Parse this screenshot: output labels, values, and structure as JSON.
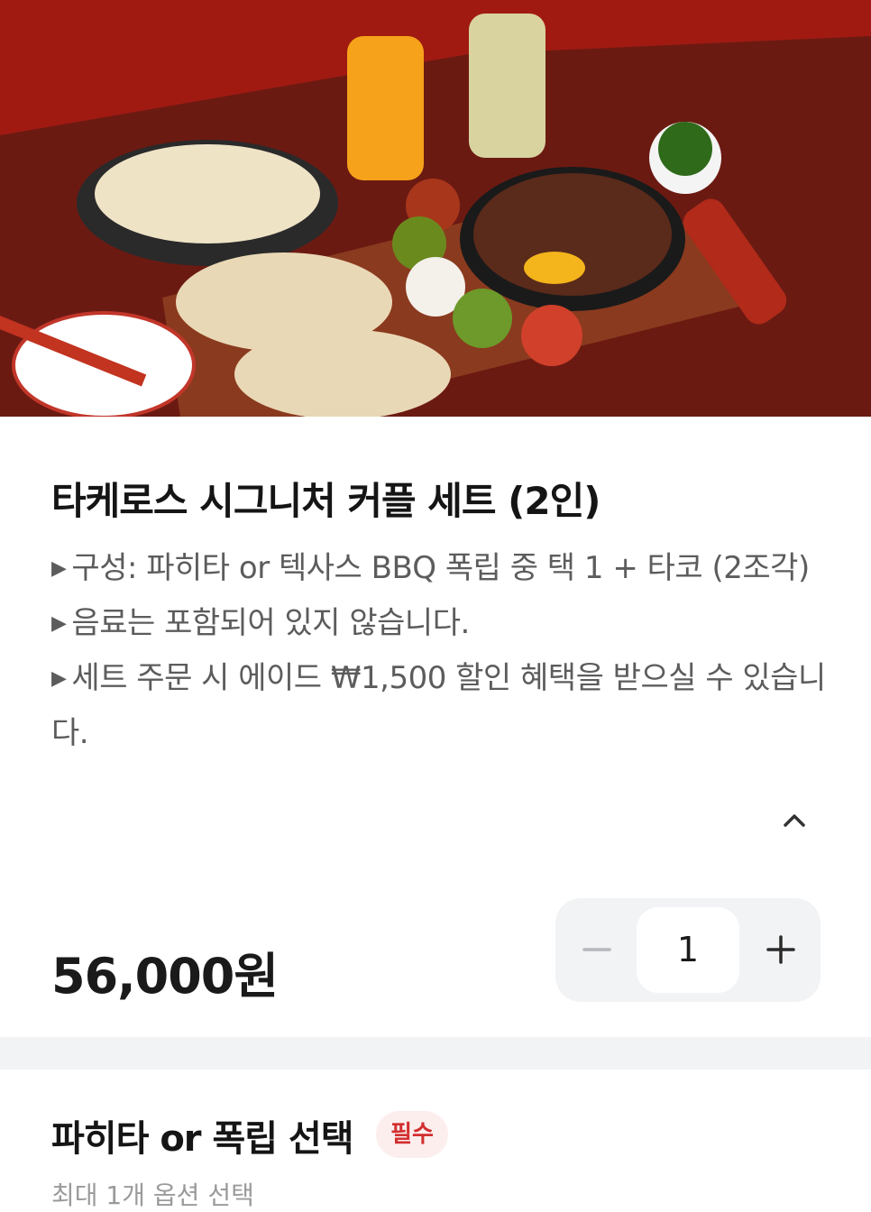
{
  "product": {
    "title": "타케로스 시그니처 커플 세트 (2인)",
    "description": [
      "구성: 파히타 or 텍사스 BBQ 폭립 중 택 1 + 타코 (2조각)",
      "음료는 포함되어 있지 않습니다.",
      "세트 주문 시 에이드  ₩1,500  할인 혜택을 받으실 수 있습니다."
    ],
    "bullet": "▶",
    "collapse_icon": "chevron-up-icon",
    "price": "56,000원"
  },
  "quantity": {
    "value": "1",
    "minus_icon": "minus-icon",
    "plus_icon": "plus-icon"
  },
  "option_group": {
    "title": "파히타 or 폭립 선택",
    "badge": "필수",
    "subtitle": "최대 1개 옵션 선택"
  },
  "colors": {
    "accent_red": "#d22f2f",
    "badge_bg": "#fdeeee",
    "surface_gray": "#f2f3f5"
  }
}
